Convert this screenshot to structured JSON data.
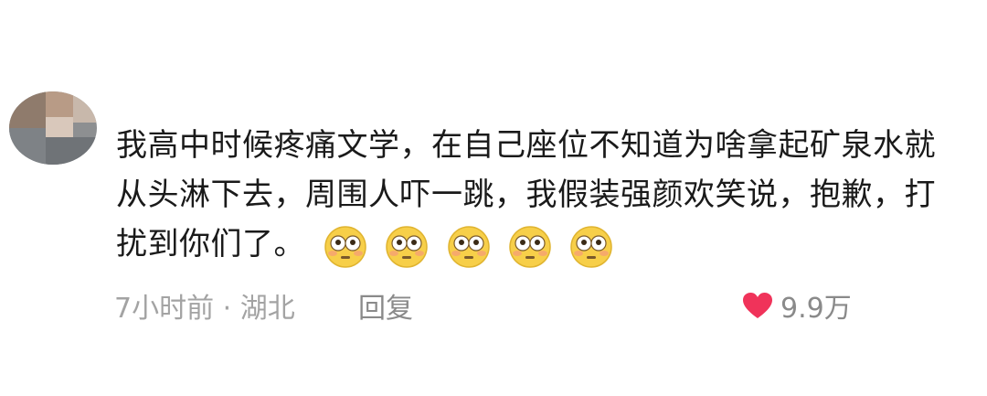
{
  "comment": {
    "text": "我高中时候疼痛文学，在自己座位不知道为啥拿起矿泉水就从头淋下去，周围人吓一跳，我假装强颜欢笑说，抱歉，打扰到你们了。",
    "emojis": [
      "flushed-face-icon",
      "flushed-face-icon",
      "flushed-face-icon",
      "flushed-face-icon",
      "flushed-face-icon"
    ]
  },
  "meta": {
    "time_location": "7小时前 · 湖北",
    "reply_label": "回复",
    "like_count": "9.9万"
  },
  "colors": {
    "heart": "#f0335a",
    "meta_text": "#a3a3a3",
    "body_text": "#1a1a1a"
  }
}
